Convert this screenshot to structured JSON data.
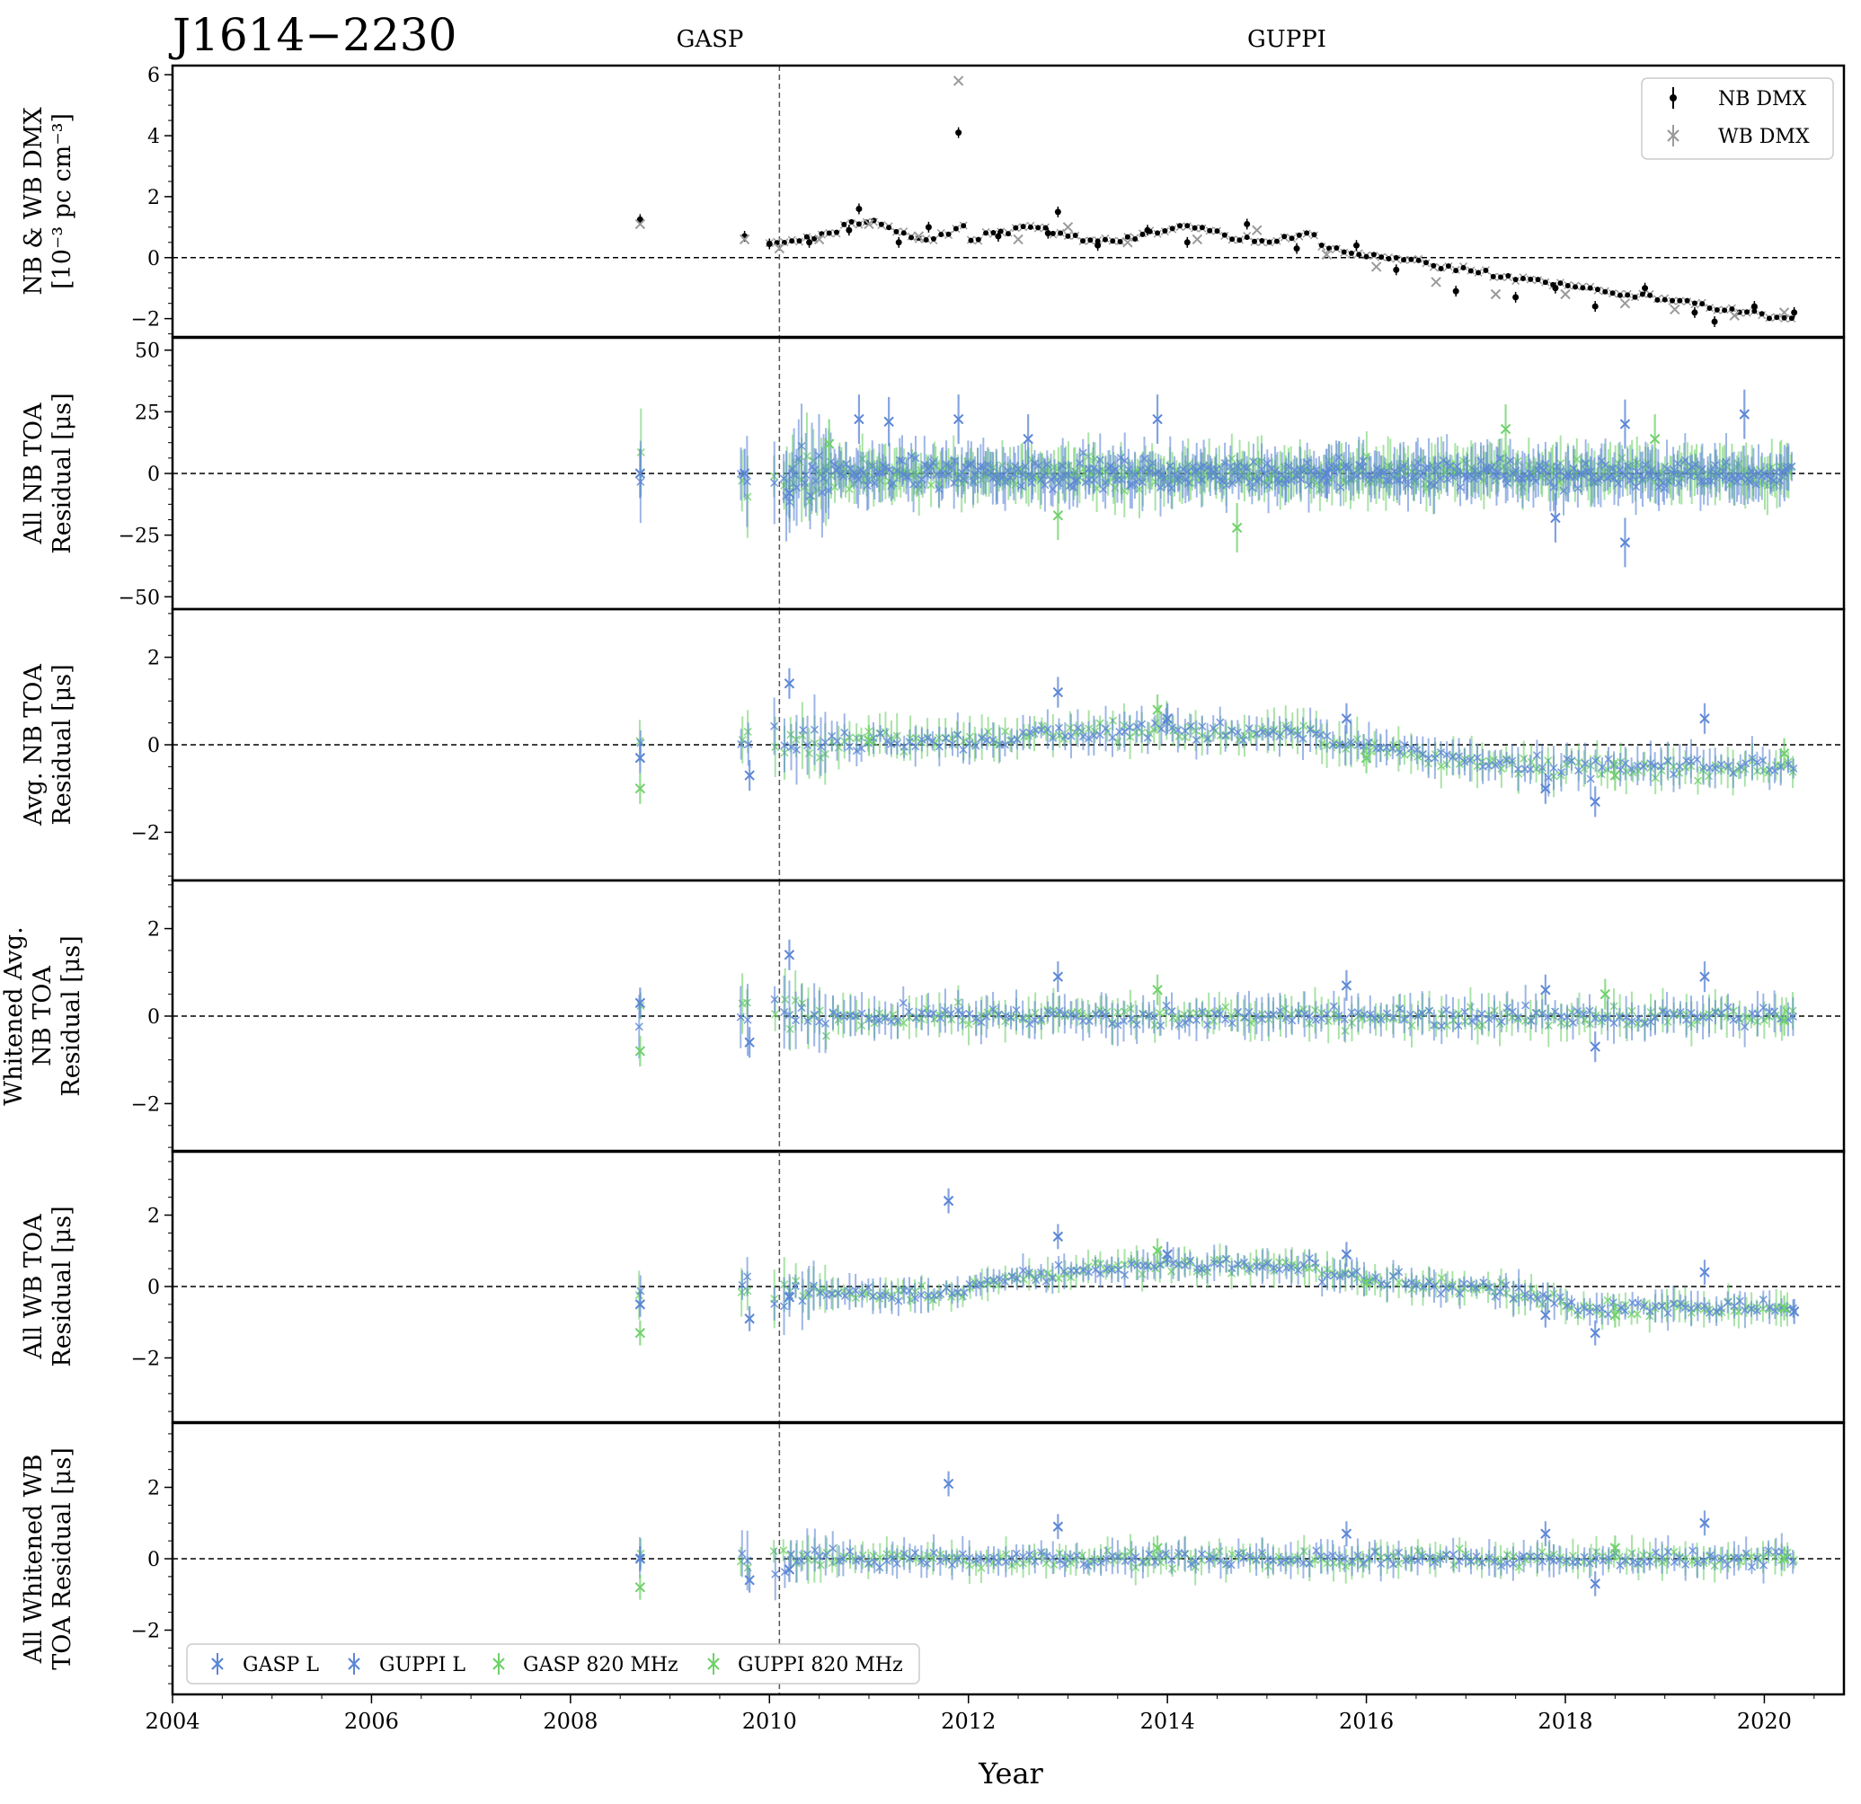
{
  "title": "J1614−2230",
  "backend_labels": [
    {
      "text": "GASP",
      "x_year": 2009.15
    },
    {
      "text": "GUPPI",
      "x_year": 2015.15
    }
  ],
  "transition_year": 2010.1,
  "xaxis": {
    "label": "Year",
    "range": [
      2004,
      2020.8
    ],
    "ticks": [
      2004,
      2006,
      2008,
      2010,
      2012,
      2014,
      2016,
      2018,
      2020
    ],
    "tick_labels": [
      "2004",
      "2006",
      "2008",
      "2010",
      "2012",
      "2014",
      "2016",
      "2018",
      "2020"
    ]
  },
  "colors": {
    "nb_dmx": "#000000",
    "wb_dmx": "#9a9a9a",
    "L_band": "#5b86d6",
    "b820": "#6fd16a"
  },
  "legend_top": [
    {
      "label": "NB DMX",
      "marker": "dot"
    },
    {
      "label": "WB DMX",
      "marker": "x"
    }
  ],
  "legend_bottom": [
    {
      "label": "GASP L",
      "band": "L"
    },
    {
      "label": "GUPPI L",
      "band": "L"
    },
    {
      "label": "GASP 820 MHz",
      "band": "820"
    },
    {
      "label": "GUPPI 820 MHz",
      "band": "820"
    }
  ],
  "chart_data": [
    {
      "type": "scatter",
      "panel": "dmx",
      "ylabel": [
        "NB & WB DMX",
        "[10⁻³ pc cm⁻³]"
      ],
      "ylim": [
        -2.6,
        6.3
      ],
      "yticks": [
        -2,
        0,
        2,
        4,
        6
      ],
      "ytick_labels": [
        "−2",
        "0",
        "2",
        "4",
        "6"
      ],
      "series": [
        {
          "name": "NB DMX",
          "points": [
            [
              2008.7,
              1.25
            ],
            [
              2009.75,
              0.7
            ],
            [
              2010.0,
              0.45
            ],
            [
              2010.4,
              0.5
            ],
            [
              2010.8,
              0.9
            ],
            [
              2010.9,
              1.6
            ],
            [
              2011.3,
              0.5
            ],
            [
              2011.6,
              1.0
            ],
            [
              2011.9,
              4.1
            ],
            [
              2012.3,
              0.7
            ],
            [
              2012.8,
              0.8
            ],
            [
              2012.9,
              1.5
            ],
            [
              2013.3,
              0.4
            ],
            [
              2013.8,
              0.9
            ],
            [
              2014.2,
              0.5
            ],
            [
              2014.8,
              1.1
            ],
            [
              2015.3,
              0.3
            ],
            [
              2015.9,
              0.4
            ],
            [
              2016.3,
              -0.4
            ],
            [
              2016.9,
              -1.1
            ],
            [
              2017.5,
              -1.3
            ],
            [
              2017.9,
              -1.0
            ],
            [
              2018.3,
              -1.6
            ],
            [
              2018.8,
              -1.0
            ],
            [
              2019.3,
              -1.8
            ],
            [
              2019.5,
              -2.1
            ],
            [
              2019.9,
              -1.6
            ],
            [
              2020.3,
              -1.8
            ]
          ]
        },
        {
          "name": "WB DMX",
          "points": [
            [
              2008.7,
              1.1
            ],
            [
              2009.75,
              0.6
            ],
            [
              2010.1,
              0.3
            ],
            [
              2010.5,
              0.6
            ],
            [
              2011.0,
              1.1
            ],
            [
              2011.5,
              0.7
            ],
            [
              2011.9,
              5.8
            ],
            [
              2012.5,
              0.6
            ],
            [
              2013.0,
              1.0
            ],
            [
              2013.6,
              0.5
            ],
            [
              2014.3,
              0.6
            ],
            [
              2014.9,
              0.9
            ],
            [
              2015.6,
              0.1
            ],
            [
              2016.1,
              -0.3
            ],
            [
              2016.7,
              -0.8
            ],
            [
              2017.3,
              -1.2
            ],
            [
              2018.0,
              -1.2
            ],
            [
              2018.6,
              -1.5
            ],
            [
              2019.1,
              -1.7
            ],
            [
              2019.7,
              -1.9
            ],
            [
              2020.2,
              -1.8
            ]
          ]
        }
      ]
    },
    {
      "type": "scatter",
      "panel": "all_nb",
      "ylabel": [
        "All NB TOA",
        "Residual [μs]"
      ],
      "ylim": [
        -55,
        55
      ],
      "yticks": [
        -50,
        -25,
        0,
        25,
        50
      ],
      "ytick_labels": [
        "−50",
        "−25",
        "0",
        "25",
        "50"
      ],
      "series": [
        {
          "name": "L",
          "points": [
            [
              2008.7,
              0
            ],
            [
              2009.75,
              0
            ],
            [
              2010.2,
              -8
            ],
            [
              2010.9,
              22
            ],
            [
              2011.2,
              21
            ],
            [
              2011.9,
              22
            ],
            [
              2012.6,
              14
            ],
            [
              2013.9,
              22
            ],
            [
              2015.6,
              0
            ],
            [
              2017.9,
              -18
            ],
            [
              2018.6,
              20
            ],
            [
              2018.6,
              -28
            ],
            [
              2019.8,
              24
            ]
          ]
        },
        {
          "name": "820",
          "points": [
            [
              2010.6,
              12
            ],
            [
              2012.9,
              -17
            ],
            [
              2014.7,
              -22
            ],
            [
              2017.4,
              18
            ],
            [
              2018.9,
              14
            ]
          ]
        }
      ]
    },
    {
      "type": "scatter",
      "panel": "avg_nb",
      "ylabel": [
        "Avg. NB TOA",
        "Residual [μs]"
      ],
      "ylim": [
        -3.1,
        3.1
      ],
      "yticks": [
        -2,
        0,
        2
      ],
      "ytick_labels": [
        "−2",
        "0",
        "2"
      ],
      "series": [
        {
          "name": "L",
          "points": [
            [
              2008.7,
              -0.3
            ],
            [
              2009.8,
              -0.7
            ],
            [
              2010.2,
              1.4
            ],
            [
              2012.9,
              1.2
            ],
            [
              2014.0,
              0.6
            ],
            [
              2015.8,
              0.6
            ],
            [
              2017.8,
              -1.0
            ],
            [
              2018.3,
              -1.3
            ],
            [
              2019.4,
              0.6
            ]
          ]
        },
        {
          "name": "820",
          "points": [
            [
              2008.7,
              -1.0
            ],
            [
              2011.0,
              0.1
            ],
            [
              2013.9,
              0.8
            ],
            [
              2016.0,
              -0.3
            ],
            [
              2018.5,
              -0.7
            ],
            [
              2020.2,
              -0.2
            ]
          ]
        }
      ]
    },
    {
      "type": "scatter",
      "panel": "whitened_avg_nb",
      "ylabel": [
        "Whitened Avg.",
        "NB TOA",
        "Residual [μs]"
      ],
      "ylim": [
        -3.1,
        3.1
      ],
      "yticks": [
        -2,
        0,
        2
      ],
      "ytick_labels": [
        "−2",
        "0",
        "2"
      ],
      "series": [
        {
          "name": "L",
          "points": [
            [
              2008.7,
              0.3
            ],
            [
              2009.8,
              -0.6
            ],
            [
              2010.2,
              1.4
            ],
            [
              2012.9,
              0.9
            ],
            [
              2015.8,
              0.7
            ],
            [
              2017.8,
              0.6
            ],
            [
              2018.3,
              -0.7
            ],
            [
              2019.4,
              0.9
            ]
          ]
        },
        {
          "name": "820",
          "points": [
            [
              2008.7,
              -0.8
            ],
            [
              2013.9,
              0.6
            ],
            [
              2018.4,
              0.5
            ],
            [
              2020.2,
              -0.1
            ]
          ]
        }
      ]
    },
    {
      "type": "scatter",
      "panel": "all_wb",
      "ylabel": [
        "All WB TOA",
        "Residual [μs]"
      ],
      "ylim": [
        -3.8,
        3.8
      ],
      "yticks": [
        -2,
        0,
        2
      ],
      "ytick_labels": [
        "−2",
        "0",
        "2"
      ],
      "series": [
        {
          "name": "L",
          "points": [
            [
              2008.7,
              -0.5
            ],
            [
              2009.8,
              -0.9
            ],
            [
              2010.2,
              -0.3
            ],
            [
              2011.8,
              2.4
            ],
            [
              2012.9,
              1.4
            ],
            [
              2014.0,
              0.9
            ],
            [
              2015.8,
              0.9
            ],
            [
              2017.8,
              -0.8
            ],
            [
              2018.3,
              -1.3
            ],
            [
              2019.4,
              0.4
            ],
            [
              2020.3,
              -0.7
            ]
          ]
        },
        {
          "name": "820",
          "points": [
            [
              2008.7,
              -1.3
            ],
            [
              2013.9,
              1.0
            ],
            [
              2016.0,
              0.1
            ],
            [
              2018.5,
              -0.8
            ],
            [
              2020.2,
              -0.6
            ]
          ]
        }
      ]
    },
    {
      "type": "scatter",
      "panel": "whitened_wb",
      "ylabel": [
        "All Whitened WB",
        "TOA Residual [μs]"
      ],
      "ylim": [
        -3.8,
        3.8
      ],
      "yticks": [
        -2,
        0,
        2
      ],
      "ytick_labels": [
        "−2",
        "0",
        "2"
      ],
      "series": [
        {
          "name": "L",
          "points": [
            [
              2008.7,
              0.0
            ],
            [
              2009.8,
              -0.6
            ],
            [
              2010.2,
              -0.3
            ],
            [
              2011.8,
              2.1
            ],
            [
              2012.9,
              0.9
            ],
            [
              2015.8,
              0.7
            ],
            [
              2017.8,
              0.7
            ],
            [
              2018.3,
              -0.7
            ],
            [
              2019.4,
              1.0
            ]
          ]
        },
        {
          "name": "820",
          "points": [
            [
              2008.7,
              -0.8
            ],
            [
              2013.9,
              0.3
            ],
            [
              2018.5,
              0.3
            ],
            [
              2020.2,
              0.0
            ]
          ]
        }
      ]
    }
  ]
}
